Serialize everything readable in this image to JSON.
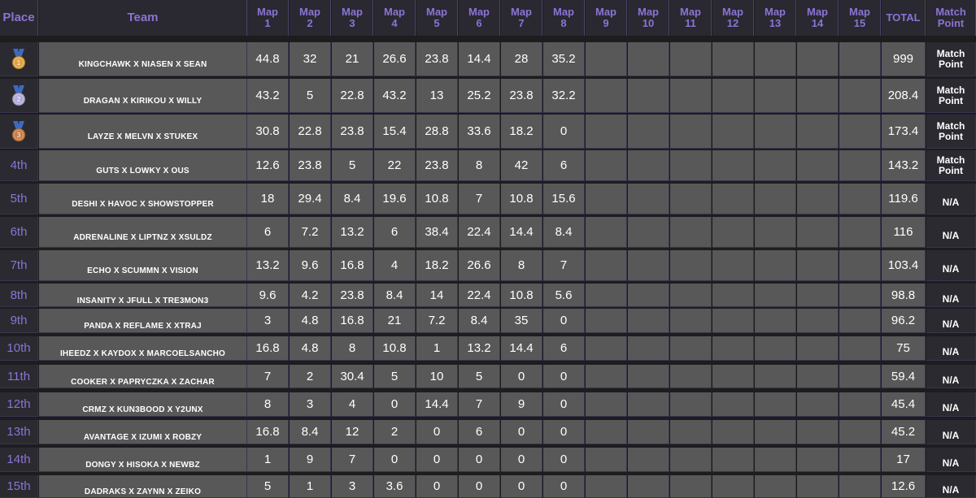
{
  "header": {
    "place": "Place",
    "team": "Team",
    "maps": [
      [
        "Map",
        "1"
      ],
      [
        "Map",
        "2"
      ],
      [
        "Map",
        "3"
      ],
      [
        "Map",
        "4"
      ],
      [
        "Map",
        "5"
      ],
      [
        "Map",
        "6"
      ],
      [
        "Map",
        "7"
      ],
      [
        "Map",
        "8"
      ],
      [
        "Map",
        "9"
      ],
      [
        "Map",
        "10"
      ],
      [
        "Map",
        "11"
      ],
      [
        "Map",
        "12"
      ],
      [
        "Map",
        "13"
      ],
      [
        "Map",
        "14"
      ],
      [
        "Map",
        "15"
      ]
    ],
    "total": "TOTAL",
    "match_point": [
      "Match",
      "Point"
    ]
  },
  "medals": {
    "gold": "#e0a23b",
    "silver": "#b0a8d8",
    "bronze": "#c97a44",
    "ribbon": "#3d6ac4"
  },
  "rows": [
    {
      "place": "1",
      "medal": "gold",
      "team": "KINGCHAWK X NIASEN X SEAN",
      "scores": [
        "44.8",
        "32",
        "21",
        "26.6",
        "23.8",
        "14.4",
        "28",
        "35.2"
      ],
      "total": "999",
      "mp": [
        "Match",
        "Point"
      ]
    },
    {
      "place": "2",
      "medal": "silver",
      "team": "DRAGAN X KIRIKOU X WILLY",
      "scores": [
        "43.2",
        "5",
        "22.8",
        "43.2",
        "13",
        "25.2",
        "23.8",
        "32.2"
      ],
      "total": "208.4",
      "mp": [
        "Match",
        "Point"
      ]
    },
    {
      "place": "3",
      "medal": "bronze",
      "team": "LAYZE X MELVN X STUKEX",
      "scores": [
        "30.8",
        "22.8",
        "23.8",
        "15.4",
        "28.8",
        "33.6",
        "18.2",
        "0"
      ],
      "total": "173.4",
      "mp": [
        "Match",
        "Point"
      ]
    },
    {
      "place": "4th",
      "medal": "",
      "team": "GUTS X LOWKY X OUS",
      "scores": [
        "12.6",
        "23.8",
        "5",
        "22",
        "23.8",
        "8",
        "42",
        "6"
      ],
      "total": "143.2",
      "mp": [
        "Match",
        "Point"
      ]
    },
    {
      "place": "5th",
      "medal": "",
      "team": "DESHI X HAVOC X SHOWSTOPPER",
      "scores": [
        "18",
        "29.4",
        "8.4",
        "19.6",
        "10.8",
        "7",
        "10.8",
        "15.6"
      ],
      "total": "119.6",
      "mp": [
        "N/A"
      ]
    },
    {
      "place": "6th",
      "medal": "",
      "team": "ADRENALINE X LIPTNZ X XSULDZ",
      "scores": [
        "6",
        "7.2",
        "13.2",
        "6",
        "38.4",
        "22.4",
        "14.4",
        "8.4"
      ],
      "total": "116",
      "mp": [
        "N/A"
      ]
    },
    {
      "place": "7th",
      "medal": "",
      "team": "ECHO X SCUMMN X VISION",
      "scores": [
        "13.2",
        "9.6",
        "16.8",
        "4",
        "18.2",
        "26.6",
        "8",
        "7"
      ],
      "total": "103.4",
      "mp": [
        "N/A"
      ]
    },
    {
      "place": "8th",
      "medal": "",
      "team": "INSANITY X JFULL X TRE3MON3",
      "scores": [
        "9.6",
        "4.2",
        "23.8",
        "8.4",
        "14",
        "22.4",
        "10.8",
        "5.6"
      ],
      "total": "98.8",
      "mp": [
        "N/A"
      ]
    },
    {
      "place": "9th",
      "medal": "",
      "team": "PANDA X REFLAME X XTRAJ",
      "scores": [
        "3",
        "4.8",
        "16.8",
        "21",
        "7.2",
        "8.4",
        "35",
        "0"
      ],
      "total": "96.2",
      "mp": [
        "N/A"
      ]
    },
    {
      "place": "10th",
      "medal": "",
      "team": "IHEEDZ X KAYDOX X MARCOELSANCHO",
      "scores": [
        "16.8",
        "4.8",
        "8",
        "10.8",
        "1",
        "13.2",
        "14.4",
        "6"
      ],
      "total": "75",
      "mp": [
        "N/A"
      ]
    },
    {
      "place": "11th",
      "medal": "",
      "team": "COOKER X PAPRYCZKA X ZACHAR",
      "scores": [
        "7",
        "2",
        "30.4",
        "5",
        "10",
        "5",
        "0",
        "0"
      ],
      "total": "59.4",
      "mp": [
        "N/A"
      ]
    },
    {
      "place": "12th",
      "medal": "",
      "team": "CRMZ X KUN3BOOD X Y2UNX",
      "scores": [
        "8",
        "3",
        "4",
        "0",
        "14.4",
        "7",
        "9",
        "0"
      ],
      "total": "45.4",
      "mp": [
        "N/A"
      ]
    },
    {
      "place": "13th",
      "medal": "",
      "team": "AVANTAGE X IZUMI X ROBZY",
      "scores": [
        "16.8",
        "8.4",
        "12",
        "2",
        "0",
        "6",
        "0",
        "0"
      ],
      "total": "45.2",
      "mp": [
        "N/A"
      ]
    },
    {
      "place": "14th",
      "medal": "",
      "team": "DONGY X HISOKA X NEWBZ",
      "scores": [
        "1",
        "9",
        "7",
        "0",
        "0",
        "0",
        "0",
        "0"
      ],
      "total": "17",
      "mp": [
        "N/A"
      ]
    },
    {
      "place": "15th",
      "medal": "",
      "team": "DADRAKS X ZAYNN X ZEIKO",
      "scores": [
        "5",
        "1",
        "3",
        "3.6",
        "0",
        "0",
        "0",
        "0"
      ],
      "total": "12.6",
      "mp": [
        "N/A"
      ]
    }
  ]
}
